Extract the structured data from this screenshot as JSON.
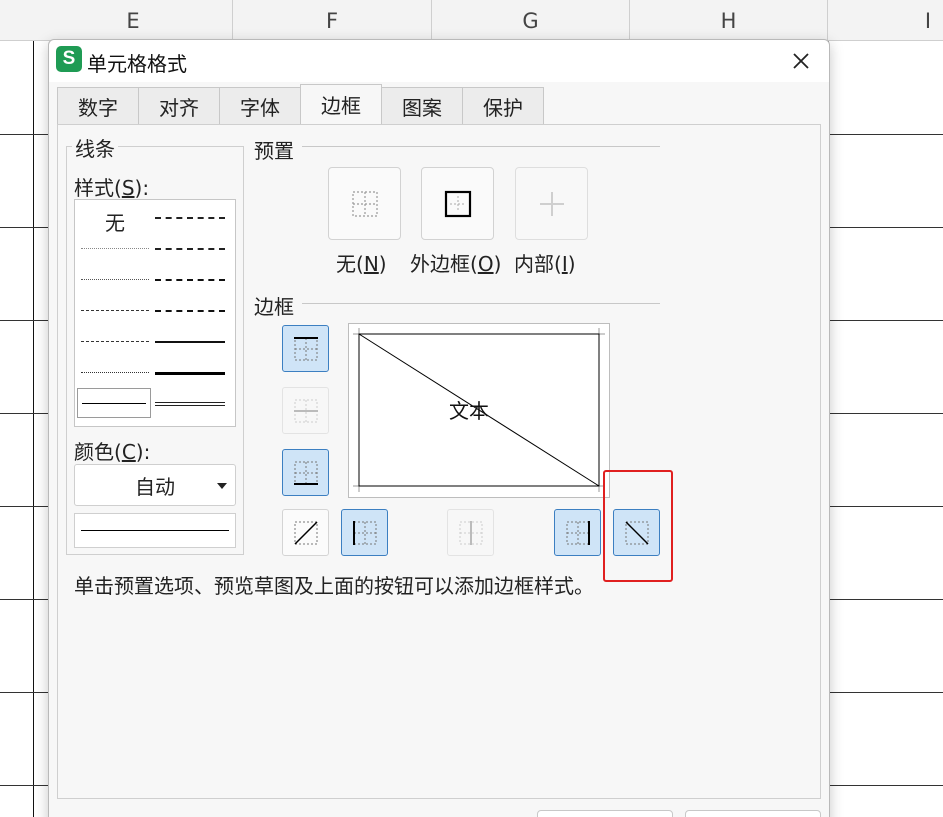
{
  "spreadsheet": {
    "columns": [
      "E",
      "F",
      "G",
      "H",
      "I"
    ]
  },
  "dialog": {
    "app_logo": "S",
    "title": "单元格格式",
    "close_icon": "close-icon",
    "tabs": [
      {
        "label": "数字",
        "active": false
      },
      {
        "label": "对齐",
        "active": false
      },
      {
        "label": "字体",
        "active": false
      },
      {
        "label": "边框",
        "active": true
      },
      {
        "label": "图案",
        "active": false
      },
      {
        "label": "保护",
        "active": false
      }
    ],
    "line_group": {
      "legend": "线条",
      "style_label_pre": "样式(",
      "style_label_key": "S",
      "style_label_post": "):",
      "style_none": "无",
      "color_label_pre": "颜色(",
      "color_label_key": "C",
      "color_label_post": "):",
      "color_value": "自动"
    },
    "presets": {
      "title": "预置",
      "items": [
        {
          "pre": "无(",
          "key": "N",
          "post": ")",
          "icon": "preset-none-icon",
          "enabled": true
        },
        {
          "pre": "外边框(",
          "key": "O",
          "post": ")",
          "icon": "preset-outline-icon",
          "enabled": true
        },
        {
          "pre": "内部(",
          "key": "I",
          "post": ")",
          "icon": "preset-inside-icon",
          "enabled": false
        }
      ]
    },
    "border": {
      "title": "边框",
      "preview_text": "文本",
      "buttons": {
        "top": {
          "icon": "border-top-icon",
          "pressed": true
        },
        "inside_horizontal": {
          "icon": "border-inside-horizontal-icon",
          "enabled": false
        },
        "bottom": {
          "icon": "border-bottom-icon",
          "pressed": true
        },
        "diagonal_up": {
          "icon": "diagonal-up-icon",
          "pressed": false
        },
        "left": {
          "icon": "border-left-icon",
          "pressed": true
        },
        "inside_vertical": {
          "icon": "border-inside-vertical-icon",
          "enabled": false
        },
        "right": {
          "icon": "border-right-icon",
          "pressed": true
        },
        "diagonal_down": {
          "icon": "diagonal-down-icon",
          "pressed": true
        }
      }
    },
    "hint": "单击预置选项、预览草图及上面的按钮可以添加边框样式。",
    "colors": {
      "accent": "#3c7fc1",
      "pressed_bg": "#cfe4f7",
      "highlight": "#e02020",
      "logo": "#1f9b54"
    }
  }
}
